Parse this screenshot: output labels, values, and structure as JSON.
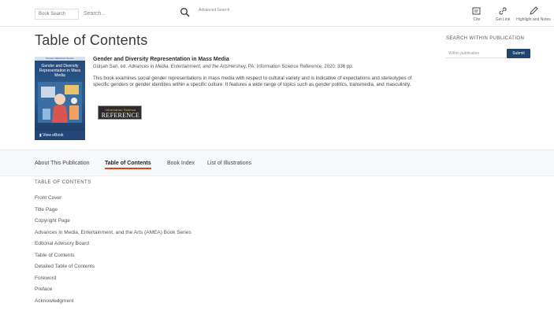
{
  "header": {
    "search_scope": "Book Search",
    "search_placeholder": "Search...",
    "advanced_search": "Advanced Search",
    "tools": {
      "cite": "Cite",
      "get_link": "Get Link",
      "highlight": "Highlight and Notes"
    }
  },
  "page_title": "Table of Contents",
  "search_within": {
    "title": "SEARCH WITHIN PUBLICATION",
    "placeholder": "Within publication",
    "submit": "Submit"
  },
  "book": {
    "cover": {
      "top_band": "Premier Reference Source",
      "title": "Gender and Diversity Representation in Mass Media",
      "view_ebook": "View eBook"
    },
    "title": "Gender and Diversity Representation in Mass Media",
    "meta_prefix": "Gülşah Sari, ed.",
    "meta_series": "Advances in Media, Entertainment, and the Arts",
    "meta_suffix": "Hershey, PA: Information Science Reference, 2020. 336 pp.",
    "description": "This book examines social gender representations in mass media with respect to cultural variety and is indicative of expectations and stereotypes of specific genders or gender identities within a specific culture. It features a wide range of topics such as gender politics, transmedia, and masculinity.",
    "publisher": {
      "line1": "Information Science",
      "line2": "REFERENCE"
    }
  },
  "tabs": {
    "about": "About This Publication",
    "toc": "Table of Contents",
    "index": "Book Index",
    "illustrations": "List of Illustrations"
  },
  "toc": {
    "heading": "TABLE OF CONTENTS",
    "items": [
      "Front Cover",
      "Title Page",
      "Copyright Page",
      "Advances in Media, Entertainment, and the Arts (AMEA) Book Series",
      "Editorial Advisory Board",
      "Table of Contents",
      "Detailed Table of Contents",
      "Foreword",
      "Preface",
      "Acknowledgment"
    ]
  },
  "colors": {
    "accent_tab": "#d9471f",
    "brand_blue": "#20466f"
  }
}
